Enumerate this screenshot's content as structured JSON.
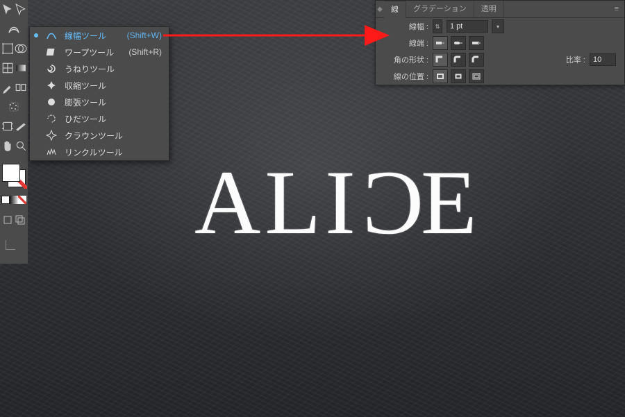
{
  "artwork_text": "ALICE",
  "flyout": {
    "items": [
      {
        "label": "線幅ツール",
        "shortcut": "(Shift+W)",
        "icon": "width-tool-icon",
        "selected": true
      },
      {
        "label": "ワープツール",
        "shortcut": "(Shift+R)",
        "icon": "warp-tool-icon",
        "selected": false
      },
      {
        "label": "うねりツール",
        "shortcut": "",
        "icon": "twirl-tool-icon",
        "selected": false
      },
      {
        "label": "収縮ツール",
        "shortcut": "",
        "icon": "pucker-tool-icon",
        "selected": false
      },
      {
        "label": "膨張ツール",
        "shortcut": "",
        "icon": "bloat-tool-icon",
        "selected": false
      },
      {
        "label": "ひだツール",
        "shortcut": "",
        "icon": "scallop-tool-icon",
        "selected": false
      },
      {
        "label": "クラウンツール",
        "shortcut": "",
        "icon": "crystallize-tool-icon",
        "selected": false
      },
      {
        "label": "リンクルツール",
        "shortcut": "",
        "icon": "wrinkle-tool-icon",
        "selected": false
      }
    ]
  },
  "panel": {
    "tabs": {
      "t1": "線",
      "t2": "グラデーション",
      "t3": "透明"
    },
    "rows": {
      "weight_label": "線幅 :",
      "weight_value": "1 pt",
      "cap_label": "線端 :",
      "corner_label": "角の形状 :",
      "ratio_label": "比率 :",
      "ratio_value": "10",
      "align_label": "線の位置 :"
    }
  }
}
